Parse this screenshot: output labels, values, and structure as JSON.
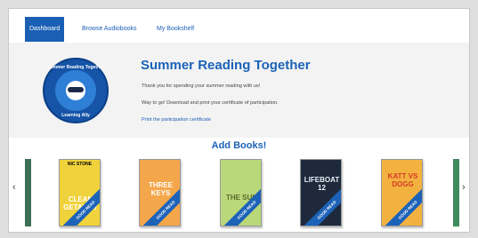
{
  "nav": {
    "tabs": [
      {
        "label": "Dashboard"
      },
      {
        "label": "Browse Audiobooks"
      },
      {
        "label": "My Bookshelf"
      }
    ]
  },
  "hero": {
    "badge_top": "Summer Reading Together",
    "badge_bottom": "Learning Ally",
    "title": "Summer Reading Together",
    "line1": "Thank you for spending your summer reading with us!",
    "line2": "Way to go! Download and print your certificate of participation.",
    "link": "Print the participation certificate"
  },
  "section": {
    "title": "Add Books!"
  },
  "carousel": {
    "prev": "‹",
    "next": "›",
    "books": [
      {
        "author": "NIC STONE",
        "title": "CLEAN GETAWAY",
        "ribbon": "GOOD READ",
        "color": "#f0d23c"
      },
      {
        "author": "",
        "title": "THREE KEYS",
        "ribbon": "GOOD READ",
        "color": "#f4a64a"
      },
      {
        "author": "",
        "title": "THE SUN",
        "ribbon": "GOOD READ",
        "color": "#b9d87a"
      },
      {
        "author": "",
        "title": "LIFEBOAT 12",
        "ribbon": "GOOD READ",
        "color": "#1e2a3c"
      },
      {
        "author": "",
        "title": "KATT VS DOGG",
        "ribbon": "GOOD READ",
        "color": "#f3b23f"
      }
    ]
  }
}
